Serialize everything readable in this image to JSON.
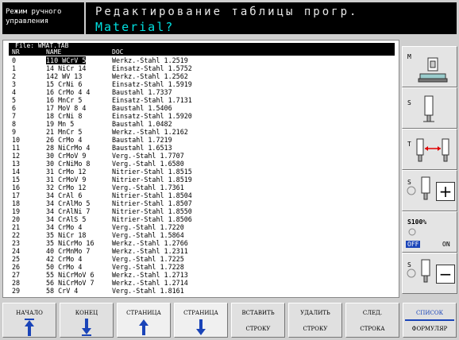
{
  "header": {
    "mode_line1": "Режим ручного",
    "mode_line2": "управления",
    "title": "Редактирование таблицы прогр.",
    "subtitle": "Material?"
  },
  "file": {
    "label": "File: WMAT.TAB"
  },
  "table": {
    "columns": [
      "NR",
      "NAME",
      "DOC"
    ],
    "rows": [
      {
        "nr": "0",
        "name": "110 WCrV 5",
        "doc": "Werkz.-Stahl 1.2519"
      },
      {
        "nr": "1",
        "name": "14 NiCr 14",
        "doc": "Einsatz-Stahl 1.5752"
      },
      {
        "nr": "2",
        "name": "142 WV 13",
        "doc": "Werkz.-Stahl 1.2562"
      },
      {
        "nr": "3",
        "name": "15 CrNi 6",
        "doc": "Einsatz-Stahl 1.5919"
      },
      {
        "nr": "4",
        "name": "16 CrMo 4 4",
        "doc": "Baustahl 1.7337"
      },
      {
        "nr": "5",
        "name": "16 MnCr 5",
        "doc": "Einsatz-Stahl 1.7131"
      },
      {
        "nr": "6",
        "name": "17 MoV 8 4",
        "doc": "Baustahl 1.5406"
      },
      {
        "nr": "7",
        "name": "18 CrNi 8",
        "doc": "Einsatz-Stahl 1.5920"
      },
      {
        "nr": "8",
        "name": "19 Mn 5",
        "doc": "Baustahl 1.0482"
      },
      {
        "nr": "9",
        "name": "21 MnCr 5",
        "doc": "Werkz.-Stahl 1.2162"
      },
      {
        "nr": "10",
        "name": "26 CrMo 4",
        "doc": "Baustahl 1.7219"
      },
      {
        "nr": "11",
        "name": "28 NiCrMo 4",
        "doc": "Baustahl 1.6513"
      },
      {
        "nr": "12",
        "name": "30 CrMoV 9",
        "doc": "Verg.-Stahl 1.7707"
      },
      {
        "nr": "13",
        "name": "30 CrNiMo 8",
        "doc": "Verg.-Stahl 1.6580"
      },
      {
        "nr": "14",
        "name": "31 CrMo 12",
        "doc": "Nitrier-Stahl 1.8515"
      },
      {
        "nr": "15",
        "name": "31 CrMoV 9",
        "doc": "Nitrier-Stahl 1.8519"
      },
      {
        "nr": "16",
        "name": "32 CrMo 12",
        "doc": "Verg.-Stahl 1.7361"
      },
      {
        "nr": "17",
        "name": "34 CrAl 6",
        "doc": "Nitrier-Stahl 1.8504"
      },
      {
        "nr": "18",
        "name": "34 CrAlMo 5",
        "doc": "Nitrier-Stahl 1.8507"
      },
      {
        "nr": "19",
        "name": "34 CrAlNi 7",
        "doc": "Nitrier-Stahl 1.8550"
      },
      {
        "nr": "20",
        "name": "34 CrAlS 5",
        "doc": "Nitrier-Stahl 1.8506"
      },
      {
        "nr": "21",
        "name": "34 CrMo 4",
        "doc": "Verg.-Stahl 1.7220"
      },
      {
        "nr": "22",
        "name": "35 NiCr 18",
        "doc": "Verg.-Stahl 1.5864"
      },
      {
        "nr": "23",
        "name": "35 NiCrMo 16",
        "doc": "Werkz.-Stahl 1.2766"
      },
      {
        "nr": "24",
        "name": "40 CrMnMo 7",
        "doc": "Werkz.-Stahl 1.2311"
      },
      {
        "nr": "25",
        "name": "42 CrMo 4",
        "doc": "Verg.-Stahl 1.7225"
      },
      {
        "nr": "26",
        "name": "50 CrMo 4",
        "doc": "Verg.-Stahl 1.7228"
      },
      {
        "nr": "27",
        "name": "55 NiCrMoV 6",
        "doc": "Werkz.-Stahl 1.2713"
      },
      {
        "nr": "28",
        "name": "56 NiCrMoV 7",
        "doc": "Werkz.-Stahl 1.2714"
      },
      {
        "nr": "29",
        "name": "58 CrV 4",
        "doc": "Verg.-Stahl 1.8161"
      }
    ]
  },
  "side": {
    "m_label": "M",
    "s_label": "S",
    "t_label": "T",
    "s2_label": "S",
    "feed_label": "S100%",
    "off_label": "OFF",
    "on_label": "ON",
    "s3_label": "S"
  },
  "softkeys": [
    {
      "line1": "НАЧАЛО",
      "line2": ""
    },
    {
      "line1": "КОНЕЦ",
      "line2": ""
    },
    {
      "line1": "СТРАНИЦА",
      "line2": ""
    },
    {
      "line1": "СТРАНИЦА",
      "line2": ""
    },
    {
      "line1": "ВСТАВИТЬ",
      "line2": "СТРОКУ"
    },
    {
      "line1": "УДАЛИТЬ",
      "line2": "СТРОКУ"
    },
    {
      "line1": "СЛЕД.",
      "line2": "СТРОКА"
    },
    {
      "line1": "СПИСОК",
      "line2": "ФОРМУЛЯР"
    }
  ],
  "colors": {
    "accent": "#1a44b8",
    "cyan": "#00e0e0",
    "red": "#e00000"
  }
}
